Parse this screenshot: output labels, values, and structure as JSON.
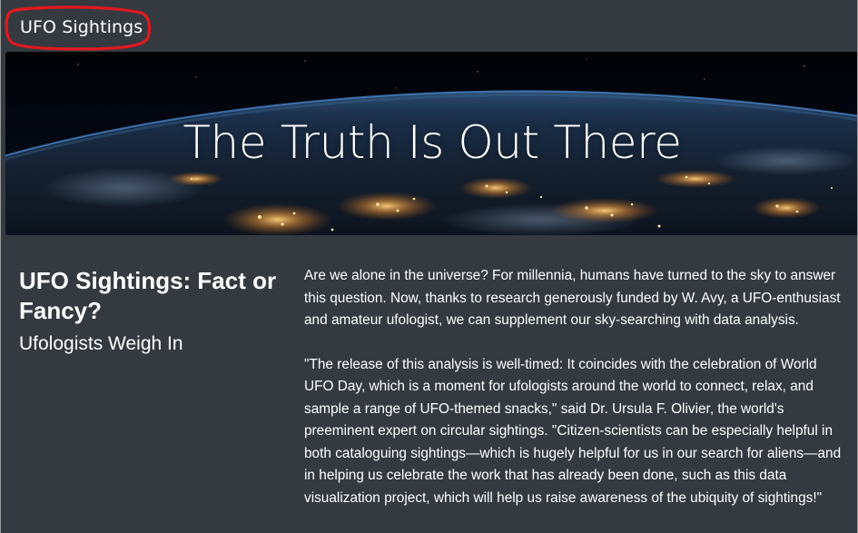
{
  "navbar": {
    "brand": "UFO Sightings"
  },
  "hero": {
    "title": "The Truth Is Out There"
  },
  "main": {
    "headline": "UFO Sightings: Fact or Fancy?",
    "subheadline": "Ufologists Weigh In",
    "paragraphs": [
      "Are we alone in the universe? For millennia, humans have turned to the sky to answer this question. Now, thanks to research generously funded by W. Avy, a UFO-enthusiast and amateur ufologist, we can supplement our sky-searching with data analysis.",
      "\"The release of this analysis is well-timed: It coincides with the celebration of World UFO Day, which is a moment for ufologists around the world to connect, relax, and sample a range of UFO-themed snacks,\" said Dr. Ursula F. Olivier, the world's preeminent expert on circular sightings. \"Citizen-scientists can be especially helpful in both cataloguing sightings—which is hugely helpful for us in our search for aliens—and in helping us celebrate the work that has already been done, such as this data visualization project, which will help us raise awareness of the ubiquity of sightings!\""
    ]
  },
  "colors": {
    "page_background": "#343a40",
    "text": "#ffffff",
    "annotation": "#e0191f"
  }
}
